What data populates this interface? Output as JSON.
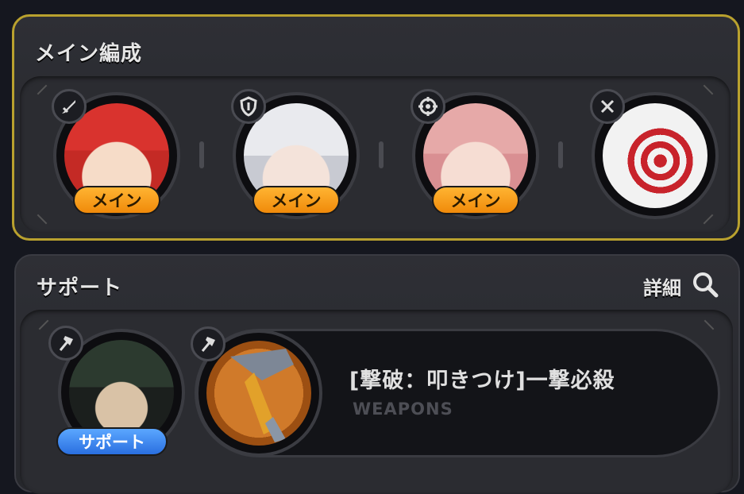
{
  "main_formation": {
    "title": "メイン編成",
    "slots": [
      {
        "role": "メイン",
        "class_icon": "sword-icon",
        "character": "red-haired-character"
      },
      {
        "role": "メイン",
        "class_icon": "shield-icon",
        "character": "silver-haired-character"
      },
      {
        "role": "メイン",
        "class_icon": "crosshair-gear-icon",
        "character": "pink-haired-glasses-character"
      },
      {
        "role": "",
        "class_icon": "close-icon",
        "character": "target-dummy"
      }
    ]
  },
  "support": {
    "title": "サポート",
    "detail_label": "詳細",
    "member": {
      "role": "サポート",
      "class_icon": "axe-icon",
      "character": "dark-haired-sunglasses-character"
    },
    "weapon": {
      "name": "[撃破：叩きつけ]一撃必殺",
      "category": "WEAPONS",
      "class_icon": "axe-icon"
    }
  },
  "colors": {
    "main_border": "#b9a12e",
    "main_pill": "#f5970f",
    "support_pill": "#3b86f0"
  }
}
